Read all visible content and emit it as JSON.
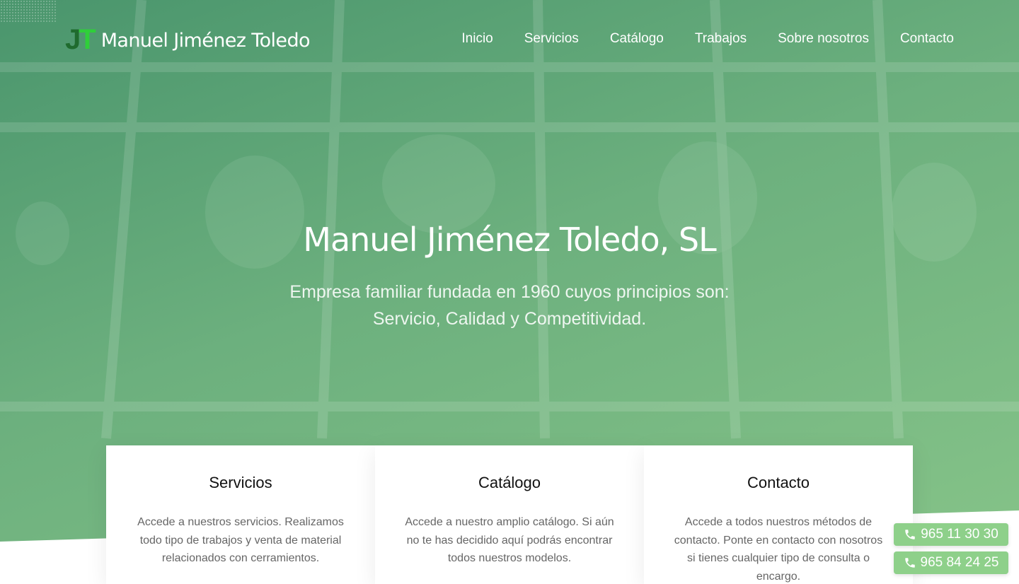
{
  "header": {
    "logo_mark_j": "J",
    "logo_mark_t": "T",
    "logo_text": "Manuel Jiménez Toledo"
  },
  "nav": {
    "items": [
      {
        "label": "Inicio"
      },
      {
        "label": "Servicios"
      },
      {
        "label": "Catálogo"
      },
      {
        "label": "Trabajos"
      },
      {
        "label": "Sobre nosotros"
      },
      {
        "label": "Contacto"
      }
    ]
  },
  "hero": {
    "title": "Manuel Jiménez Toledo, SL",
    "subtitle_line1": "Empresa familiar fundada en 1960 cuyos principios son:",
    "subtitle_line2": "Servicio, Calidad y Competitividad."
  },
  "cards": [
    {
      "title": "Servicios",
      "text": "Accede a nuestros servicios. Realizamos todo tipo de trabajos y venta de material relacionados con cerramientos."
    },
    {
      "title": "Catálogo",
      "text": "Accede a nuestro amplio catálogo. Si aún no te has decidido aquí podrás encontrar todos nuestros modelos."
    },
    {
      "title": "Contacto",
      "text": "Accede a todos nuestros métodos de contacto. Ponte en contacto con nosotros si tienes cualquier tipo de consulta o encargo."
    }
  ],
  "phones": [
    {
      "number": "965 11 30 30",
      "icon": "phone-icon"
    },
    {
      "number": "965 84 24 25",
      "icon": "phone-icon"
    }
  ],
  "colors": {
    "hero_green": "#5aa86e",
    "logo_j": "#1f6b2e",
    "logo_t": "#2fcf3a",
    "phone_button": "#8ed08a"
  }
}
